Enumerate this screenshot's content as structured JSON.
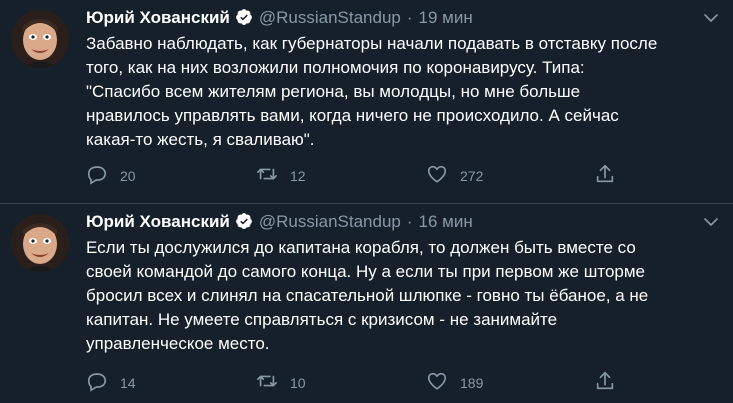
{
  "tweets": [
    {
      "author_name": "Юрий Хованский",
      "handle": "@RussianStandup",
      "separator": "·",
      "time": "19 мин",
      "text": "Забавно наблюдать, как губернаторы начали подавать в отставку после\nтого, как на них возложили полномочия по коронавирусу. Типа:\n\"Спасибо всем жителям региона, вы молодцы, но мне больше\nнравилось управлять вами, когда ничего не происходило. А сейчас\nкакая-то жесть, я сваливаю\".",
      "replies": "20",
      "retweets": "12",
      "likes": "272"
    },
    {
      "author_name": "Юрий Хованский",
      "handle": "@RussianStandup",
      "separator": "·",
      "time": "16 мин",
      "text": "Если ты дослужился до капитана корабля, то должен быть вместе со\nсвоей командой до самого конца. Ну а если ты при первом же шторме\nбросил всех и слинял на спасательной шлюпке - говно ты ёбаное, а не\nкапитан. Не умеете справляться с кризисом - не занимайте\nуправленческое место.",
      "replies": "14",
      "retweets": "10",
      "likes": "189"
    }
  ],
  "icons": {
    "reply": "reply-icon",
    "retweet": "retweet-icon",
    "like": "heart-icon",
    "share": "share-icon",
    "verified": "verified-badge-icon",
    "menu": "chevron-down-icon"
  },
  "colors": {
    "background": "#15202b",
    "text_primary": "#ffffff",
    "text_secondary": "#8899a6",
    "verified_badge": "#ffffff",
    "divider": "#38444d"
  }
}
